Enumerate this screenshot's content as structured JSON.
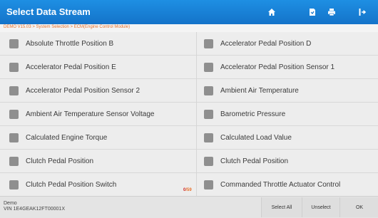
{
  "header": {
    "title": "Select Data Stream",
    "icons": [
      "home-icon",
      "report-icon",
      "print-icon",
      "exit-icon"
    ]
  },
  "breadcrumb": "DEMO V15.03 > System Selection > ECM(Engine Control Module)",
  "data_streams": {
    "left": [
      "Absolute Throttle Position B",
      "Accelerator Pedal Position E",
      "Accelerator Pedal Position Sensor 2",
      "Ambient Air Temperature Sensor Voltage",
      "Calculated Engine Torque",
      "Clutch Pedal Position",
      "Clutch Pedal Position Switch"
    ],
    "right": [
      "Accelerator Pedal Position D",
      "Accelerator Pedal Position Sensor 1",
      "Ambient Air Temperature",
      "Barometric Pressure",
      "Calculated Load Value",
      "Clutch Pedal Position",
      "Commanded Throttle Actuator Control"
    ]
  },
  "counter": {
    "selected": "0",
    "total": "/59"
  },
  "footer": {
    "vehicle_line1": "Demo",
    "vehicle_line2": "VIN 1E4GEAK12FT00001X",
    "select_all": "Select All",
    "unselect": "Unselect",
    "ok": "OK"
  },
  "colors": {
    "header_blue": "#1a82d8",
    "breadcrumb_orange": "#e8702a",
    "checkbox_gray": "#8f8f8f"
  }
}
